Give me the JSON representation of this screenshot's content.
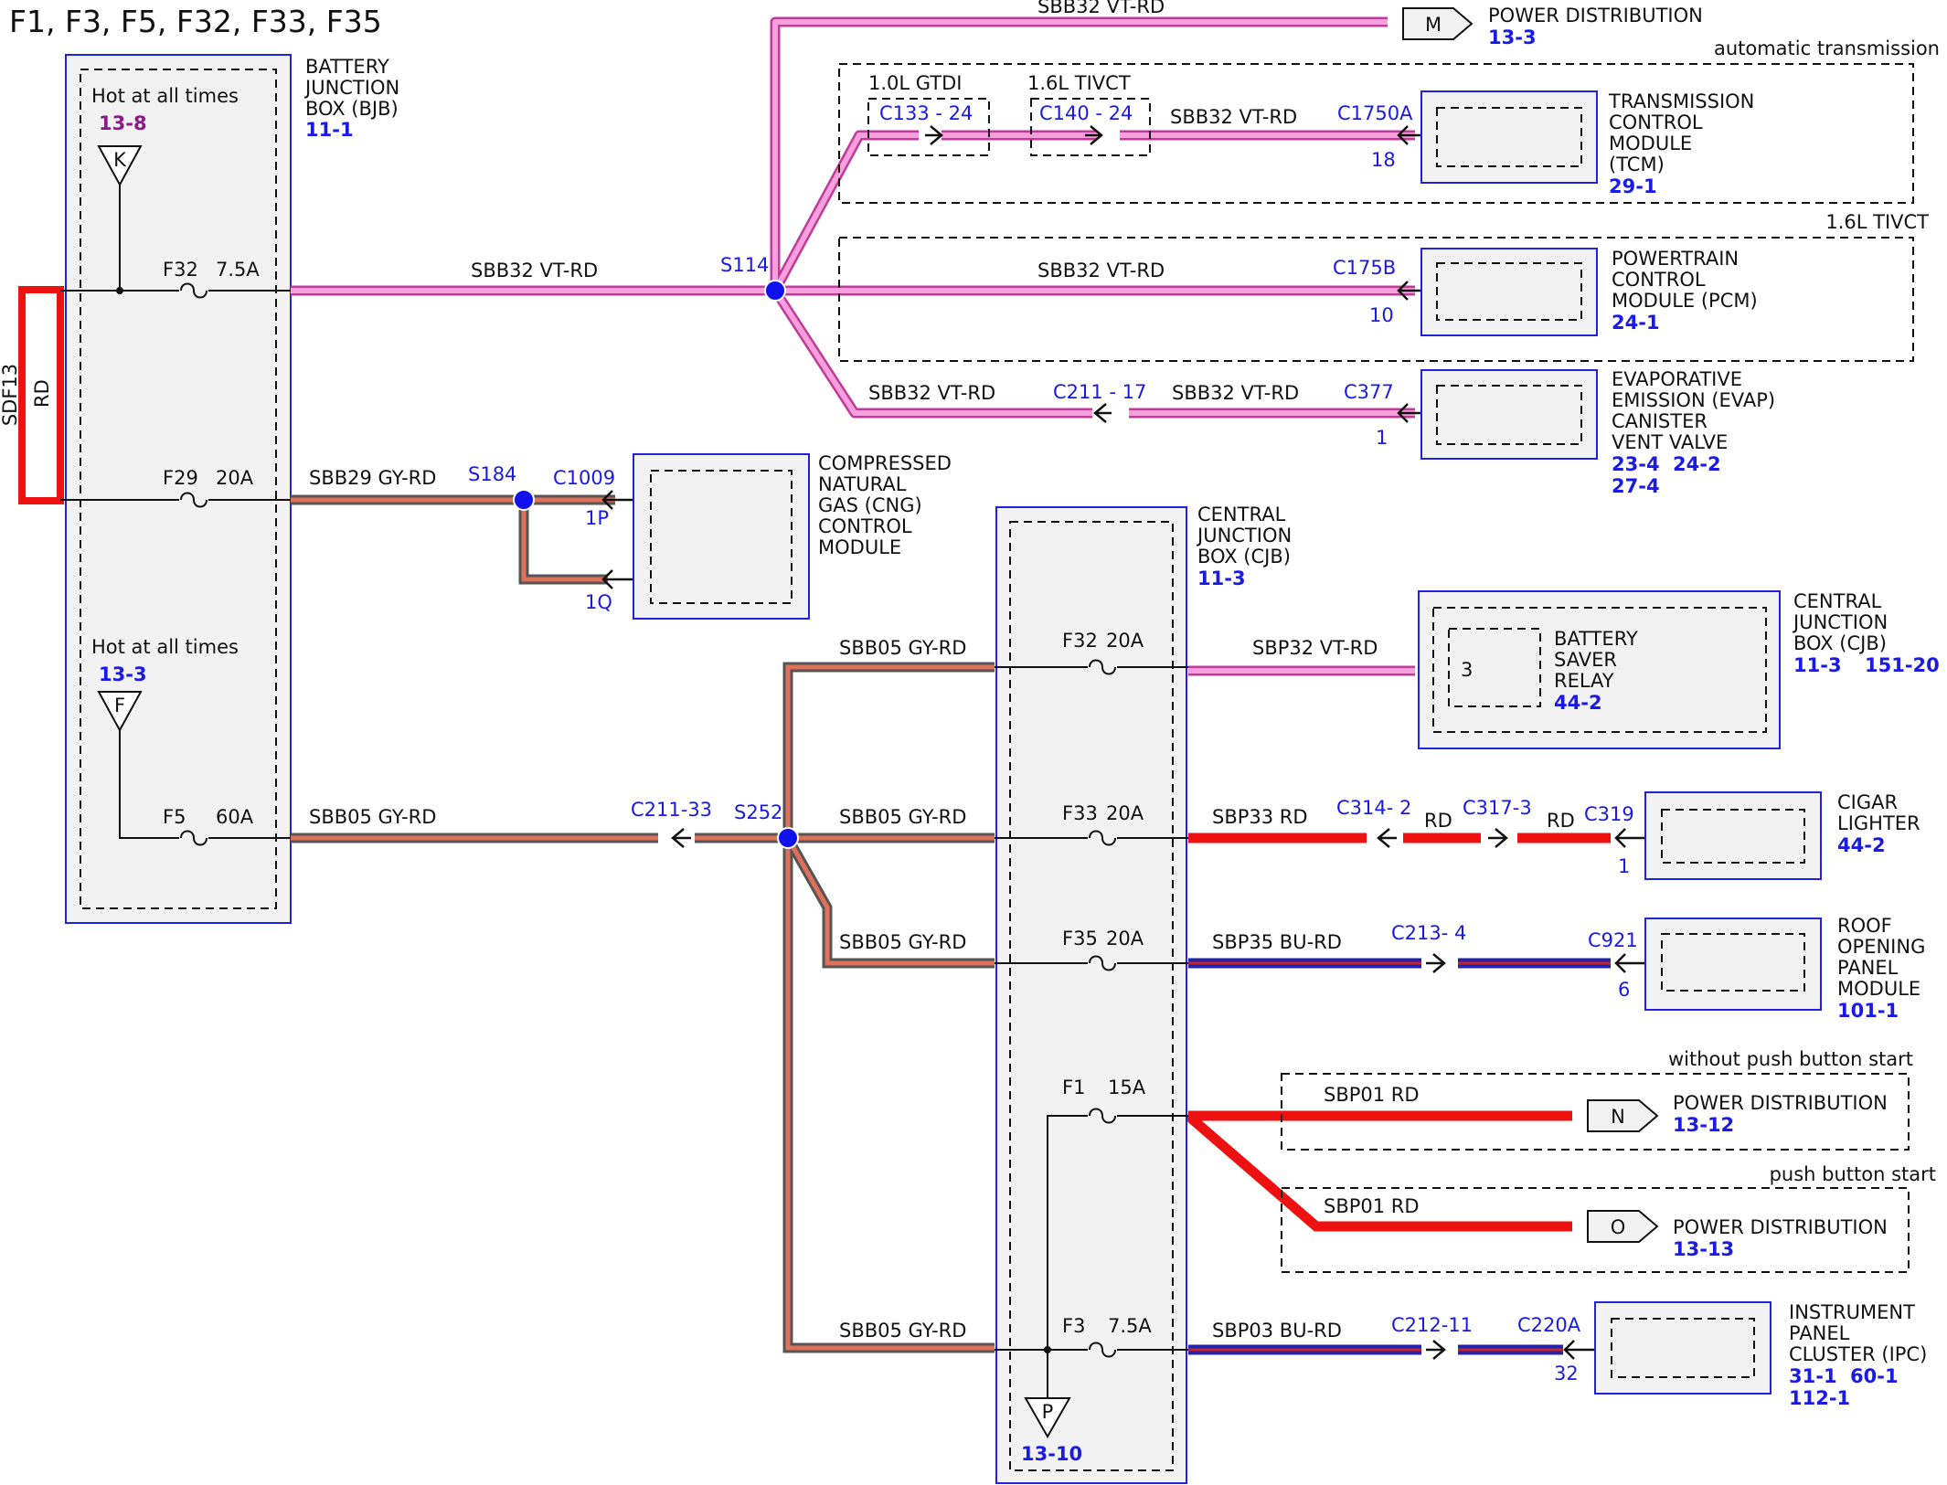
{
  "title": "F1, F3, F5, F32, F33, F35",
  "colors": {
    "vt_rd": "#f07ad0",
    "gy_rd": "#7a7a7a",
    "rd": "#ee1111",
    "bu_rd": "#2222aa",
    "box_fill": "#f2f2f2",
    "box_border": "#2222dd",
    "ref_blue": "#1a1ae6",
    "ref_purple": "#8a1a8a",
    "splice": "#1111ee"
  },
  "source": {
    "code": "SDF13",
    "color": "RD"
  },
  "bjb": {
    "label_lines": [
      "BATTERY",
      "JUNCTION",
      "BOX (BJB)"
    ],
    "ref": "11-1",
    "hot1": {
      "text": "Hot at all times",
      "ref": "13-8",
      "letter": "K"
    },
    "hot2": {
      "text": "Hot at all times",
      "ref": "13-3",
      "letter": "F"
    },
    "f32": {
      "name": "F32",
      "rating": "7.5A"
    },
    "f29": {
      "name": "F29",
      "rating": "20A"
    },
    "f5": {
      "name": "F5",
      "rating": "60A"
    }
  },
  "wires": {
    "sbb32_main": "SBB32  VT-RD",
    "sbb32_top": "SBB32  VT-RD",
    "sbb32_tcm": "SBB32  VT-RD",
    "sbb32_pcm": "SBB32  VT-RD",
    "sbb32_evap_a": "SBB32  VT-RD",
    "sbb32_evap_b": "SBB32  VT-RD",
    "sbb29": "SBB29  GY-RD",
    "sbb05_main": "SBB05  GY-RD",
    "sbb05_top": "SBB05  GY-RD",
    "sbb05_mid": "SBB05  GY-RD",
    "sbb05_f35": "SBB05  GY-RD",
    "sbb05_bot": "SBB05  GY-RD",
    "sbp32": "SBP32  VT-RD",
    "sbp33": "SBP33  RD",
    "rd1": "RD",
    "rd2": "RD",
    "sbp35": "SBP35  BU-RD",
    "sbp01_a": "SBP01  RD",
    "sbp01_b": "SBP01  RD",
    "sbp03": "SBP03  BU-RD"
  },
  "splices": {
    "s114": "S114",
    "s184": "S184",
    "s252": "S252"
  },
  "connectors": {
    "c1009": "C1009",
    "c1009_1p": "1P",
    "c1009_1q": "1Q",
    "c133": "C133 - 24",
    "c140": "C140 - 24",
    "c1750a": "C1750A",
    "c1750a_pin": "18",
    "c175b": "C175B",
    "c175b_pin": "10",
    "c211_17": "C211 - 17",
    "c377": "C377",
    "c377_pin": "1",
    "c211_33": "C211-33",
    "c314": "C314- 2",
    "c317": "C317-3",
    "c319": "C319",
    "c319_pin": "1",
    "c213": "C213- 4",
    "c921": "C921",
    "c921_pin": "6",
    "c212": "C212-11",
    "c220a": "C220A",
    "c220a_pin": "32"
  },
  "options": {
    "gtdi": "1.0L GTDI",
    "tivct": "1.6L TIVCT",
    "auto_trans": "automatic transmission",
    "tivct_pcm": "1.6L TIVCT",
    "without_push": "without push button start",
    "push": "push button start"
  },
  "components": {
    "power_dist_m": {
      "label": "POWER DISTRIBUTION",
      "ref": "13-3",
      "letter": "M"
    },
    "tcm": {
      "lines": [
        "TRANSMISSION",
        "CONTROL",
        "MODULE",
        "(TCM)"
      ],
      "ref": "29-1"
    },
    "pcm": {
      "lines": [
        "POWERTRAIN",
        "CONTROL",
        "MODULE (PCM)"
      ],
      "ref": "24-1"
    },
    "evap": {
      "lines": [
        "EVAPORATIVE",
        "EMISSION (EVAP)",
        "CANISTER",
        "VENT VALVE"
      ],
      "ref1": "23-4",
      "ref2": "24-2",
      "ref3": "27-4"
    },
    "cng": {
      "lines": [
        "COMPRESSED",
        "NATURAL",
        "GAS (CNG)",
        "CONTROL",
        "MODULE"
      ]
    },
    "cjb_relay": {
      "lines": [
        "CENTRAL",
        "JUNCTION",
        "BOX (CJB)"
      ],
      "ref1": "11-3",
      "ref2": "151-20",
      "relay_lines": [
        "BATTERY",
        "SAVER",
        "RELAY"
      ],
      "relay_ref": "44-2",
      "pin": "3"
    },
    "cigar": {
      "lines": [
        "CIGAR",
        "LIGHTER"
      ],
      "ref": "44-2"
    },
    "roof": {
      "lines": [
        "ROOF",
        "OPENING",
        "PANEL",
        "MODULE"
      ],
      "ref": "101-1"
    },
    "power_dist_n": {
      "label": "POWER DISTRIBUTION",
      "ref": "13-12",
      "letter": "N"
    },
    "power_dist_o": {
      "label": "POWER DISTRIBUTION",
      "ref": "13-13",
      "letter": "O"
    },
    "ipc": {
      "lines": [
        "INSTRUMENT",
        "PANEL",
        "CLUSTER (IPC)"
      ],
      "ref1": "31-1",
      "ref2": "60-1",
      "ref3": "112-1"
    }
  },
  "cjb": {
    "label_lines": [
      "CENTRAL",
      "JUNCTION",
      "BOX (CJB)"
    ],
    "ref": "11-3",
    "f32": {
      "name": "F32",
      "rating": "20A"
    },
    "f33": {
      "name": "F33",
      "rating": "20A"
    },
    "f35": {
      "name": "F35",
      "rating": "20A"
    },
    "f1": {
      "name": "F1",
      "rating": "15A"
    },
    "f3": {
      "name": "F3",
      "rating": "7.5A"
    },
    "p_letter": "P",
    "p_ref": "13-10"
  }
}
